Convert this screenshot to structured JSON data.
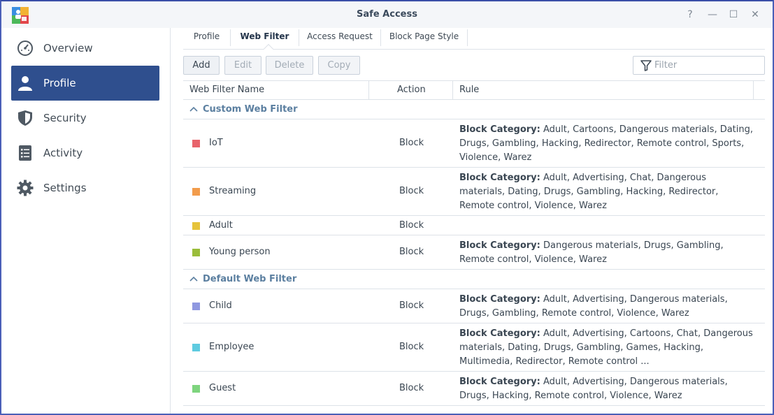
{
  "window": {
    "title": "Safe Access",
    "controls": {
      "help": "?",
      "minimize": "—",
      "maximize": "☐",
      "close": "✕"
    }
  },
  "sidebar": {
    "items": [
      {
        "label": "Overview",
        "icon": "gauge-icon",
        "active": false
      },
      {
        "label": "Profile",
        "icon": "person-icon",
        "active": true
      },
      {
        "label": "Security",
        "icon": "shield-icon",
        "active": false
      },
      {
        "label": "Activity",
        "icon": "list-icon",
        "active": false
      },
      {
        "label": "Settings",
        "icon": "gear-icon",
        "active": false
      }
    ]
  },
  "tabs": [
    {
      "label": "Profile",
      "active": false
    },
    {
      "label": "Web Filter",
      "active": true
    },
    {
      "label": "Access Request",
      "active": false
    },
    {
      "label": "Block Page Style",
      "active": false
    }
  ],
  "toolbar": {
    "add_label": "Add",
    "edit_label": "Edit",
    "delete_label": "Delete",
    "copy_label": "Copy",
    "filter_placeholder": "Filter"
  },
  "table": {
    "columns": {
      "name": "Web Filter Name",
      "action": "Action",
      "rule": "Rule"
    },
    "rule_prefix": "Block Category:",
    "groups": [
      {
        "label": "Custom Web Filter",
        "rows": [
          {
            "name": "IoT",
            "color": "#e8636b",
            "action": "Block",
            "rule": "Adult, Cartoons, Dangerous materials, Dating, Drugs, Gambling, Hacking, Redirector, Remote control, Sports, Violence, Warez"
          },
          {
            "name": "Streaming",
            "color": "#f29c4c",
            "action": "Block",
            "rule": "Adult, Advertising, Chat, Dangerous materials, Dating, Drugs, Gambling, Hacking, Redirector, Remote control, Violence, Warez"
          },
          {
            "name": "Adult",
            "color": "#e6c33a",
            "action": "Block",
            "rule": ""
          },
          {
            "name": "Young person",
            "color": "#9abd3a",
            "action": "Block",
            "rule": "Dangerous materials, Drugs, Gambling, Remote control, Violence, Warez"
          }
        ]
      },
      {
        "label": "Default Web Filter",
        "rows": [
          {
            "name": "Child",
            "color": "#8f98e0",
            "action": "Block",
            "rule": "Adult, Advertising, Dangerous materials, Drugs, Gambling, Remote control, Violence, Warez"
          },
          {
            "name": "Employee",
            "color": "#5fcbe0",
            "action": "Block",
            "rule": "Adult, Advertising, Cartoons, Chat, Dangerous materials, Dating, Drugs, Gambling, Games, Hacking, Multimedia, Redirector, Remote control ..."
          },
          {
            "name": "Guest",
            "color": "#7ed47e",
            "action": "Block",
            "rule": "Adult, Advertising, Dangerous materials, Drugs, Hacking, Remote control, Violence, Warez"
          }
        ]
      }
    ]
  },
  "colors": {
    "accent": "#2f4f8e",
    "group_label": "#5b7fa0",
    "border": "#dde2e8"
  }
}
